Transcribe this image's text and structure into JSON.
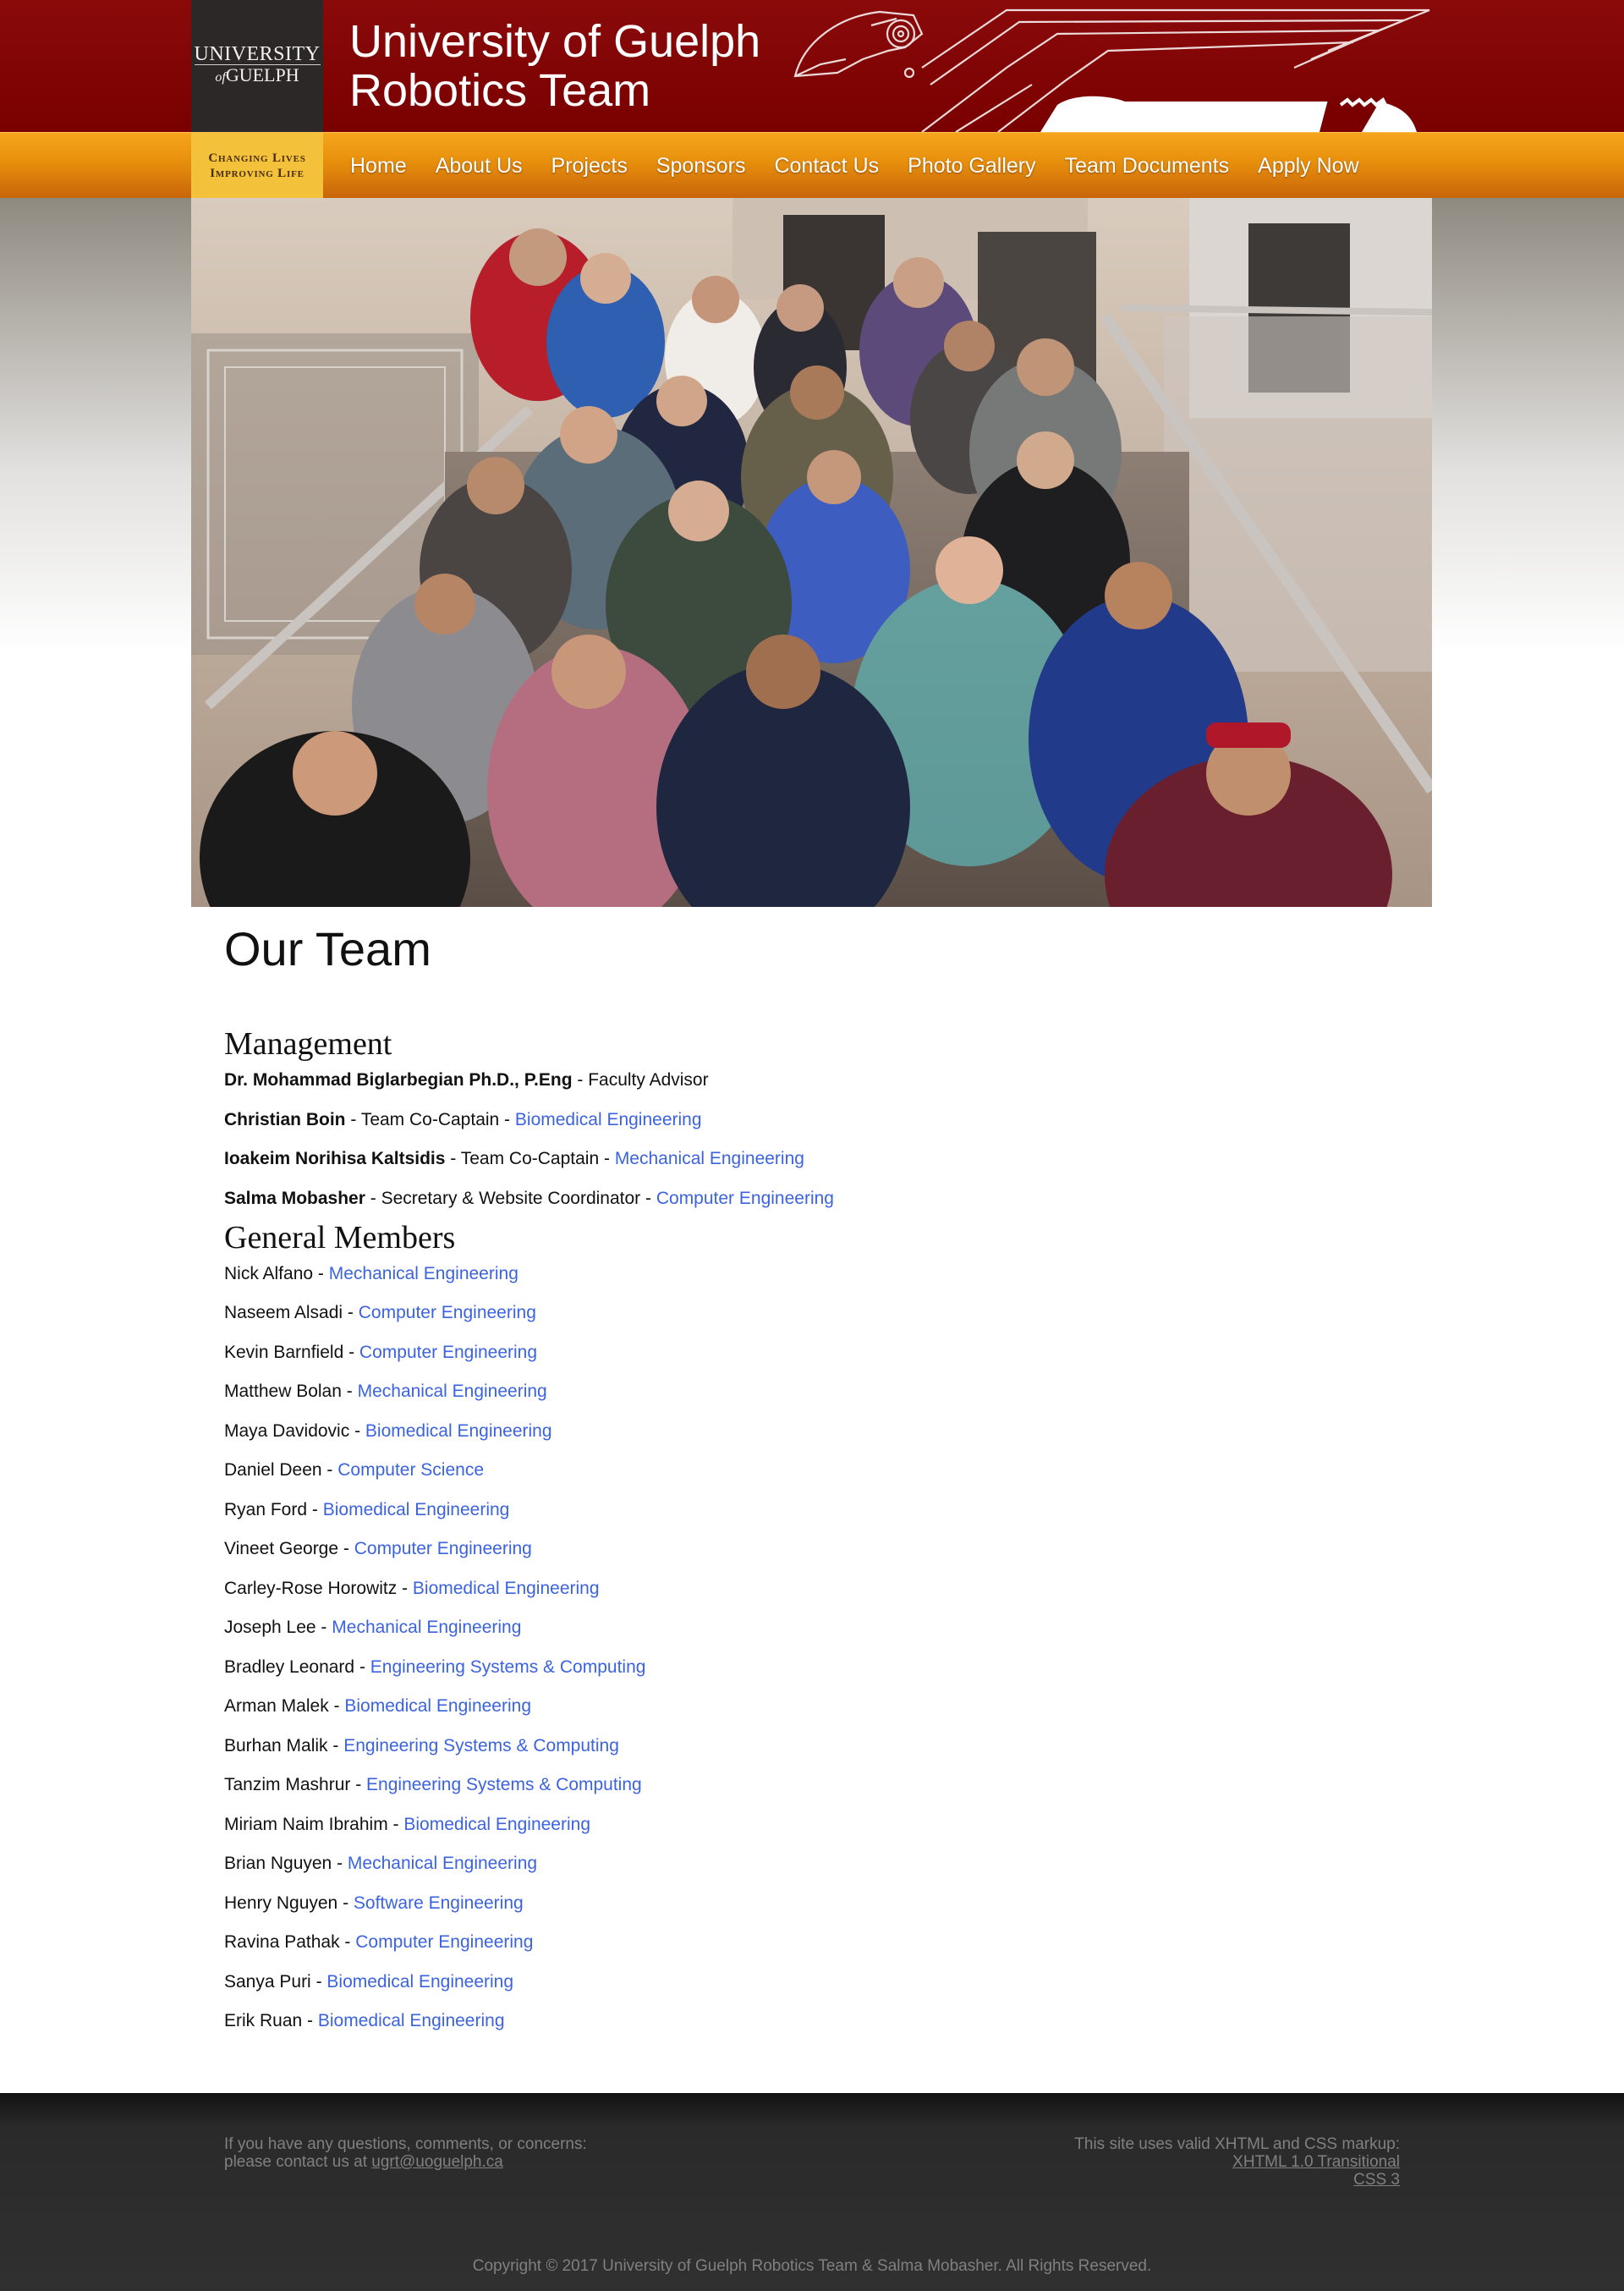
{
  "header": {
    "logo_line1": "UNIVERSITY",
    "logo_of": "of",
    "logo_line2": "GUELPH",
    "title_line1": "University of Guelph",
    "title_line2": "Robotics Team",
    "brand_color": "#7a0000"
  },
  "nav": {
    "motto_line1": "Changing Lives",
    "motto_line2": "Improving Life",
    "items": [
      {
        "label": "Home"
      },
      {
        "label": "About Us"
      },
      {
        "label": "Projects"
      },
      {
        "label": "Sponsors"
      },
      {
        "label": "Contact Us"
      },
      {
        "label": "Photo Gallery"
      },
      {
        "label": "Team Documents"
      },
      {
        "label": "Apply Now"
      }
    ],
    "accent_color": "#e78f0c"
  },
  "main": {
    "page_title": "Our Team",
    "management_title": "Management",
    "management": [
      {
        "name": "Dr. Mohammad Biglarbegian Ph.D., P.Eng",
        "role": "Faculty Advisor",
        "dept": ""
      },
      {
        "name": "Christian Boin",
        "role": "Team Co-Captain",
        "dept": "Biomedical Engineering"
      },
      {
        "name": "Ioakeim Norihisa Kaltsidis",
        "role": "Team Co-Captain",
        "dept": "Mechanical Engineering"
      },
      {
        "name": "Salma Mobasher",
        "role": "Secretary & Website Coordinator",
        "dept": "Computer Engineering"
      }
    ],
    "general_title": "General Members",
    "members": [
      {
        "name": "Nick Alfano",
        "dept": "Mechanical Engineering"
      },
      {
        "name": "Naseem Alsadi",
        "dept": "Computer Engineering"
      },
      {
        "name": "Kevin Barnfield",
        "dept": "Computer Engineering"
      },
      {
        "name": "Matthew Bolan",
        "dept": "Mechanical Engineering"
      },
      {
        "name": "Maya Davidovic",
        "dept": "Biomedical Engineering"
      },
      {
        "name": "Daniel Deen",
        "dept": "Computer Science"
      },
      {
        "name": "Ryan Ford",
        "dept": "Biomedical Engineering"
      },
      {
        "name": "Vineet George",
        "dept": "Computer Engineering"
      },
      {
        "name": "Carley-Rose Horowitz",
        "dept": "Biomedical Engineering"
      },
      {
        "name": "Joseph Lee",
        "dept": "Mechanical Engineering"
      },
      {
        "name": "Bradley Leonard",
        "dept": "Engineering Systems & Computing"
      },
      {
        "name": "Arman Malek",
        "dept": "Biomedical Engineering"
      },
      {
        "name": "Burhan Malik",
        "dept": "Engineering Systems & Computing"
      },
      {
        "name": "Tanzim Mashrur",
        "dept": "Engineering Systems & Computing"
      },
      {
        "name": "Miriam Naim Ibrahim",
        "dept": "Biomedical Engineering"
      },
      {
        "name": "Brian Nguyen",
        "dept": "Mechanical Engineering"
      },
      {
        "name": "Henry Nguyen",
        "dept": "Software Engineering"
      },
      {
        "name": "Ravina Pathak",
        "dept": "Computer Engineering"
      },
      {
        "name": "Sanya Puri",
        "dept": "Biomedical Engineering"
      },
      {
        "name": "Erik Ruan",
        "dept": "Biomedical Engineering"
      }
    ],
    "separator": " - ",
    "dept_color": "#3b63e0"
  },
  "footer": {
    "left_line1": "If you have any questions, comments, or concerns:",
    "left_line2_prefix": "please contact us at ",
    "email": "ugrt@uoguelph.ca",
    "right_line1": "This site uses valid XHTML and CSS markup:",
    "xhtml_link": "XHTML 1.0 Transitional",
    "css_link": "CSS 3",
    "copyright": "Copyright © 2017 University of Guelph Robotics Team & Salma Mobasher. All Rights Reserved."
  }
}
